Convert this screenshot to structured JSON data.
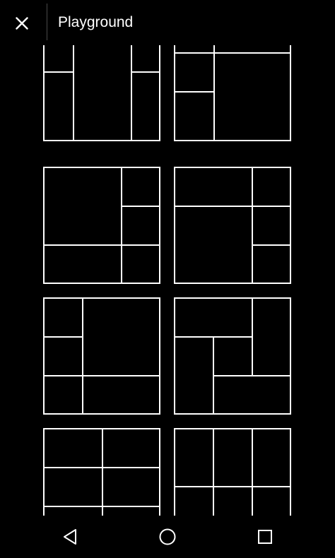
{
  "appbar": {
    "title": "Playground",
    "close_icon": "close-icon"
  },
  "layouts": [
    "layout-1",
    "layout-2",
    "layout-3",
    "layout-4",
    "layout-5",
    "layout-6",
    "layout-7",
    "layout-8"
  ],
  "navbar": {
    "back_icon": "triangle-back-icon",
    "home_icon": "circle-home-icon",
    "recents_icon": "square-recents-icon"
  },
  "colors": {
    "background": "#000000",
    "foreground": "#ffffff",
    "divider": "#4a4a4a"
  }
}
